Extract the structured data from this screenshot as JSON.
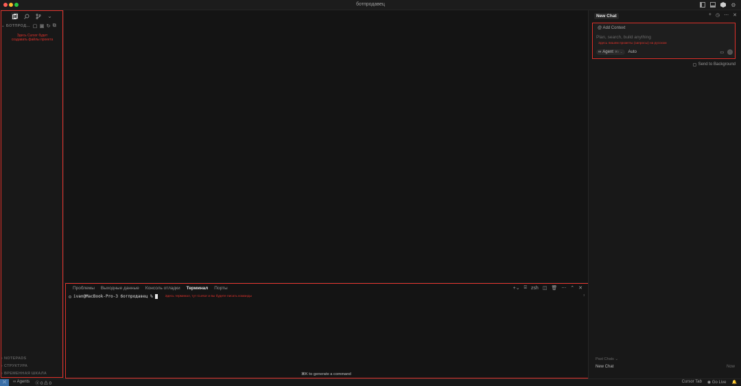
{
  "window": {
    "title": "ботпродавец"
  },
  "title_icons": [
    "sidebar-toggle-icon",
    "panel-toggle-icon",
    "cursor-logo-icon",
    "settings-icon"
  ],
  "sidebar": {
    "tabs": [
      "explorer-icon",
      "search-icon",
      "source-control-icon",
      "more-icon"
    ],
    "explorer_title": "БОТПРОД...",
    "note": "Здесь Cursor будет создавать файлы проекта",
    "sections": [
      "NOTEPADS",
      "СТРУКТУРА",
      "ВРЕМЕННАЯ ШКАЛА"
    ]
  },
  "panel": {
    "tabs": [
      "Проблемы",
      "Выходные данные",
      "Консоль отладки",
      "Терминал",
      "Порты"
    ],
    "active_tab": "Терминал",
    "shell": "zsh",
    "prompt": "ivan@MacBook-Pro-3 ботпродавец %",
    "note": "Здесь терминал, тут Cursor и вы будете писать команды",
    "generate_hint": "⌘K to generate a command"
  },
  "chat": {
    "title": "New Chat",
    "add_context": "Add Context",
    "placeholder": "Plan, search, build anything",
    "note": "Здесь пишем промпты (запросы) на русском",
    "mode": "Agent",
    "mode_shortcut": "⌘I",
    "model": "Auto",
    "send_to_background": "Send to Background",
    "past_chats_label": "Past Chats",
    "past_chats": [
      {
        "title": "New Chat",
        "time": "Now"
      }
    ]
  },
  "statusbar": {
    "agents": "Agents",
    "errors": "0",
    "warnings": "0",
    "cursor_tab": "Cursor Tab",
    "go_live": "Go Live"
  },
  "colors": {
    "annotation_red": "#e0322b",
    "background": "#141414",
    "remote_blue": "#3a6fa8"
  }
}
